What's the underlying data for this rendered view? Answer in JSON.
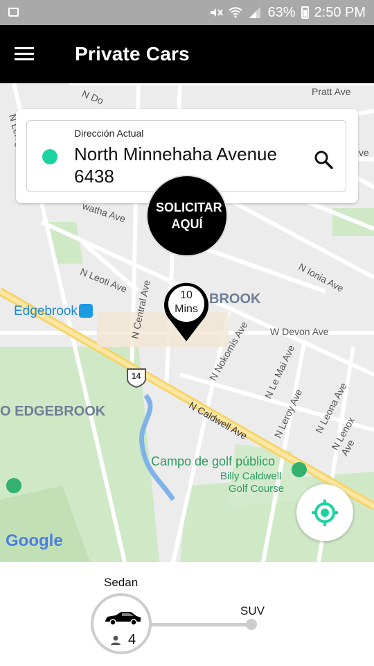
{
  "status_bar": {
    "battery": "63%",
    "time": "2:50 PM"
  },
  "app_bar": {
    "title": "Private Cars",
    "menu_icon": "hamburger-menu-icon"
  },
  "map": {
    "labels": {
      "pratt": "Pratt Ave",
      "n_do": "N Do",
      "n_lehigh": "N Lehig",
      "ave_right": "ve",
      "watha": "watha Ave",
      "n_leoti": "N Leoti Ave",
      "n_central": "N Central Ave",
      "n_ionia": "N Ionia Ave",
      "brook": "BROOK",
      "edgebrook": "Edgebrook",
      "w_devon": "W Devon Ave",
      "n_nokomis": "N Nokomis Ave",
      "n_lemai": "N Le Mai Ave",
      "n_leroy": "N Leroy Ave",
      "n_leona": "N Leona Ave",
      "n_lenox": "N Lenox Ave",
      "route14": "14",
      "o_edgebrook": "O EDGEBROOK",
      "n_caldwell": "N Caldwell Ave",
      "golf1": "Campo de golf público",
      "golf2": "Billy Caldwell",
      "golf3": "Golf Course",
      "google": "Google"
    }
  },
  "address_card": {
    "label": "Dirección Actual",
    "value": "North Minnehaha Avenue 6438",
    "dot_color": "#1bd3a0"
  },
  "request_pin": {
    "label": "SOLICITAR AQUÍ"
  },
  "eta_marker": {
    "number": "10",
    "unit": "Mins"
  },
  "locate_button": {
    "icon": "my-location-icon",
    "color": "#1bd3a0"
  },
  "vehicle_selector": {
    "options": [
      {
        "label": "Sedan",
        "passengers": "4",
        "selected": true
      },
      {
        "label": "SUV",
        "selected": false
      }
    ]
  }
}
